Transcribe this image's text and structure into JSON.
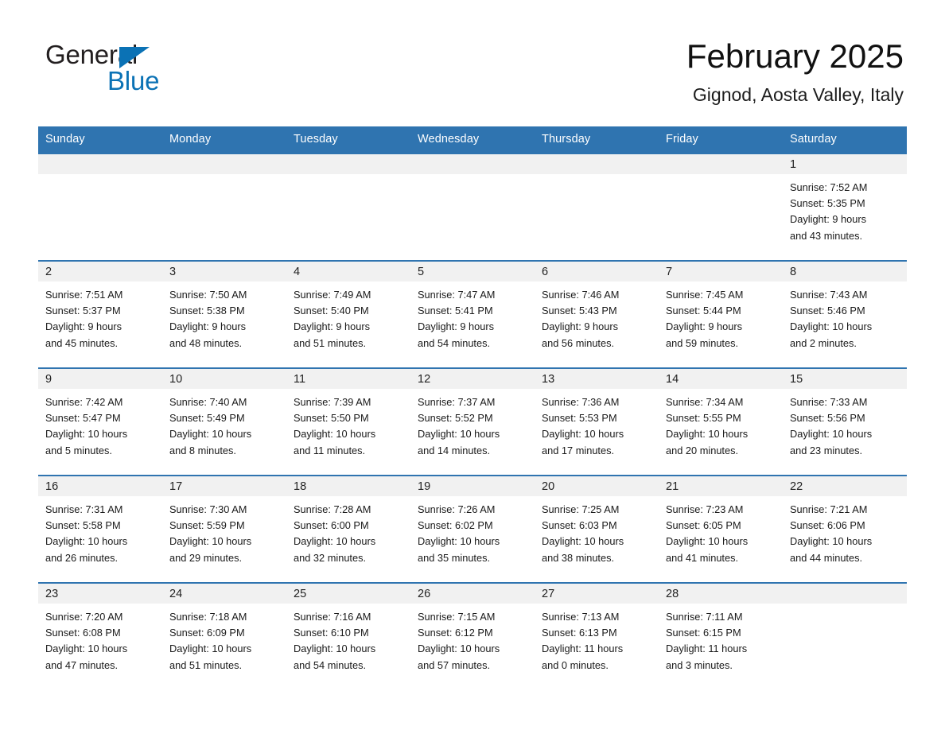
{
  "brand": {
    "word_one": "General",
    "word_two": "Blue",
    "triangle_icon": "triangle-icon",
    "accent_color": "#0b72b5"
  },
  "header": {
    "title": "February 2025",
    "subtitle": "Gignod, Aosta Valley, Italy"
  },
  "theme": {
    "header_blue": "#2f74b0",
    "day_band_gray": "#f1f1f1",
    "text_color": "#1a1a1a"
  },
  "calendar": {
    "weekdays": [
      "Sunday",
      "Monday",
      "Tuesday",
      "Wednesday",
      "Thursday",
      "Friday",
      "Saturday"
    ],
    "weeks": [
      [
        {
          "day": "",
          "lines": []
        },
        {
          "day": "",
          "lines": []
        },
        {
          "day": "",
          "lines": []
        },
        {
          "day": "",
          "lines": []
        },
        {
          "day": "",
          "lines": []
        },
        {
          "day": "",
          "lines": []
        },
        {
          "day": "1",
          "lines": [
            "Sunrise: 7:52 AM",
            "Sunset: 5:35 PM",
            "Daylight: 9 hours",
            "and 43 minutes."
          ]
        }
      ],
      [
        {
          "day": "2",
          "lines": [
            "Sunrise: 7:51 AM",
            "Sunset: 5:37 PM",
            "Daylight: 9 hours",
            "and 45 minutes."
          ]
        },
        {
          "day": "3",
          "lines": [
            "Sunrise: 7:50 AM",
            "Sunset: 5:38 PM",
            "Daylight: 9 hours",
            "and 48 minutes."
          ]
        },
        {
          "day": "4",
          "lines": [
            "Sunrise: 7:49 AM",
            "Sunset: 5:40 PM",
            "Daylight: 9 hours",
            "and 51 minutes."
          ]
        },
        {
          "day": "5",
          "lines": [
            "Sunrise: 7:47 AM",
            "Sunset: 5:41 PM",
            "Daylight: 9 hours",
            "and 54 minutes."
          ]
        },
        {
          "day": "6",
          "lines": [
            "Sunrise: 7:46 AM",
            "Sunset: 5:43 PM",
            "Daylight: 9 hours",
            "and 56 minutes."
          ]
        },
        {
          "day": "7",
          "lines": [
            "Sunrise: 7:45 AM",
            "Sunset: 5:44 PM",
            "Daylight: 9 hours",
            "and 59 minutes."
          ]
        },
        {
          "day": "8",
          "lines": [
            "Sunrise: 7:43 AM",
            "Sunset: 5:46 PM",
            "Daylight: 10 hours",
            "and 2 minutes."
          ]
        }
      ],
      [
        {
          "day": "9",
          "lines": [
            "Sunrise: 7:42 AM",
            "Sunset: 5:47 PM",
            "Daylight: 10 hours",
            "and 5 minutes."
          ]
        },
        {
          "day": "10",
          "lines": [
            "Sunrise: 7:40 AM",
            "Sunset: 5:49 PM",
            "Daylight: 10 hours",
            "and 8 minutes."
          ]
        },
        {
          "day": "11",
          "lines": [
            "Sunrise: 7:39 AM",
            "Sunset: 5:50 PM",
            "Daylight: 10 hours",
            "and 11 minutes."
          ]
        },
        {
          "day": "12",
          "lines": [
            "Sunrise: 7:37 AM",
            "Sunset: 5:52 PM",
            "Daylight: 10 hours",
            "and 14 minutes."
          ]
        },
        {
          "day": "13",
          "lines": [
            "Sunrise: 7:36 AM",
            "Sunset: 5:53 PM",
            "Daylight: 10 hours",
            "and 17 minutes."
          ]
        },
        {
          "day": "14",
          "lines": [
            "Sunrise: 7:34 AM",
            "Sunset: 5:55 PM",
            "Daylight: 10 hours",
            "and 20 minutes."
          ]
        },
        {
          "day": "15",
          "lines": [
            "Sunrise: 7:33 AM",
            "Sunset: 5:56 PM",
            "Daylight: 10 hours",
            "and 23 minutes."
          ]
        }
      ],
      [
        {
          "day": "16",
          "lines": [
            "Sunrise: 7:31 AM",
            "Sunset: 5:58 PM",
            "Daylight: 10 hours",
            "and 26 minutes."
          ]
        },
        {
          "day": "17",
          "lines": [
            "Sunrise: 7:30 AM",
            "Sunset: 5:59 PM",
            "Daylight: 10 hours",
            "and 29 minutes."
          ]
        },
        {
          "day": "18",
          "lines": [
            "Sunrise: 7:28 AM",
            "Sunset: 6:00 PM",
            "Daylight: 10 hours",
            "and 32 minutes."
          ]
        },
        {
          "day": "19",
          "lines": [
            "Sunrise: 7:26 AM",
            "Sunset: 6:02 PM",
            "Daylight: 10 hours",
            "and 35 minutes."
          ]
        },
        {
          "day": "20",
          "lines": [
            "Sunrise: 7:25 AM",
            "Sunset: 6:03 PM",
            "Daylight: 10 hours",
            "and 38 minutes."
          ]
        },
        {
          "day": "21",
          "lines": [
            "Sunrise: 7:23 AM",
            "Sunset: 6:05 PM",
            "Daylight: 10 hours",
            "and 41 minutes."
          ]
        },
        {
          "day": "22",
          "lines": [
            "Sunrise: 7:21 AM",
            "Sunset: 6:06 PM",
            "Daylight: 10 hours",
            "and 44 minutes."
          ]
        }
      ],
      [
        {
          "day": "23",
          "lines": [
            "Sunrise: 7:20 AM",
            "Sunset: 6:08 PM",
            "Daylight: 10 hours",
            "and 47 minutes."
          ]
        },
        {
          "day": "24",
          "lines": [
            "Sunrise: 7:18 AM",
            "Sunset: 6:09 PM",
            "Daylight: 10 hours",
            "and 51 minutes."
          ]
        },
        {
          "day": "25",
          "lines": [
            "Sunrise: 7:16 AM",
            "Sunset: 6:10 PM",
            "Daylight: 10 hours",
            "and 54 minutes."
          ]
        },
        {
          "day": "26",
          "lines": [
            "Sunrise: 7:15 AM",
            "Sunset: 6:12 PM",
            "Daylight: 10 hours",
            "and 57 minutes."
          ]
        },
        {
          "day": "27",
          "lines": [
            "Sunrise: 7:13 AM",
            "Sunset: 6:13 PM",
            "Daylight: 11 hours",
            "and 0 minutes."
          ]
        },
        {
          "day": "28",
          "lines": [
            "Sunrise: 7:11 AM",
            "Sunset: 6:15 PM",
            "Daylight: 11 hours",
            "and 3 minutes."
          ]
        },
        {
          "day": "",
          "lines": []
        }
      ]
    ]
  }
}
